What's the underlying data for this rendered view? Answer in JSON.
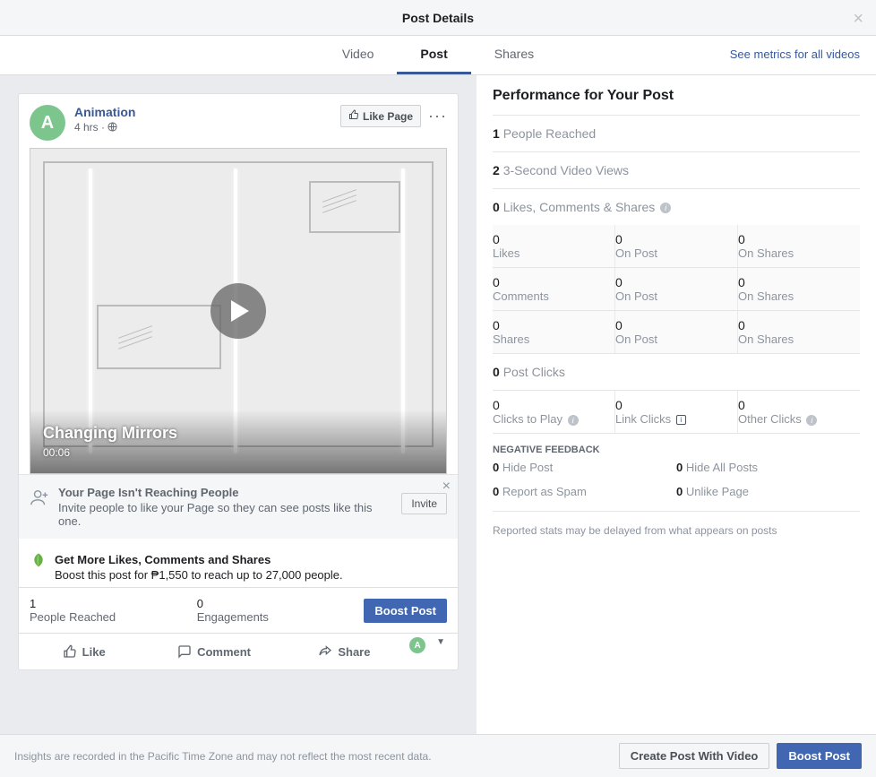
{
  "header": {
    "title": "Post Details"
  },
  "tabs": {
    "video": "Video",
    "post": "Post",
    "shares": "Shares",
    "metrics_link": "See metrics for all videos"
  },
  "post": {
    "avatar_letter": "A",
    "author": "Animation",
    "time": "4 hrs",
    "like_page": "Like Page",
    "video_title": "Changing Mirrors",
    "duration": "00:06"
  },
  "reach_prompt": {
    "title": "Your Page Isn't Reaching People",
    "sub": "Invite people to like your Page so they can see posts like this one.",
    "invite": "Invite"
  },
  "boost_prompt": {
    "title": "Get More Likes, Comments and Shares",
    "sub": "Boost this post for ₱1,550 to reach up to 27,000 people."
  },
  "stats": {
    "reached_val": "1",
    "reached_label": "People Reached",
    "eng_val": "0",
    "eng_label": "Engagements",
    "boost_btn": "Boost Post"
  },
  "actions": {
    "like": "Like",
    "comment": "Comment",
    "share": "Share",
    "mini_avatar": "A"
  },
  "performance": {
    "title": "Performance for Your Post",
    "rows": [
      {
        "val": "1",
        "label": "People Reached"
      },
      {
        "val": "2",
        "label": "3-Second Video Views"
      },
      {
        "val": "0",
        "label": "Likes, Comments & Shares",
        "info": true
      }
    ],
    "breakdown": [
      {
        "c0v": "0",
        "c0l": "Likes",
        "c1v": "0",
        "c1l": "On Post",
        "c2v": "0",
        "c2l": "On Shares"
      },
      {
        "c0v": "0",
        "c0l": "Comments",
        "c1v": "0",
        "c1l": "On Post",
        "c2v": "0",
        "c2l": "On Shares"
      },
      {
        "c0v": "0",
        "c0l": "Shares",
        "c1v": "0",
        "c1l": "On Post",
        "c2v": "0",
        "c2l": "On Shares"
      }
    ],
    "clicks_row": {
      "val": "0",
      "label": "Post Clicks"
    },
    "clicks_breakdown": {
      "c0v": "0",
      "c0l": "Clicks to Play",
      "c1v": "0",
      "c1l": "Link Clicks",
      "c2v": "0",
      "c2l": "Other Clicks"
    },
    "neg_head": "NEGATIVE FEEDBACK",
    "neg": [
      {
        "v": "0",
        "l": "Hide Post"
      },
      {
        "v": "0",
        "l": "Hide All Posts"
      },
      {
        "v": "0",
        "l": "Report as Spam"
      },
      {
        "v": "0",
        "l": "Unlike Page"
      }
    ],
    "disclaimer": "Reported stats may be delayed from what appears on posts"
  },
  "footer": {
    "note": "Insights are recorded in the Pacific Time Zone and may not reflect the most recent data.",
    "create": "Create Post With Video",
    "boost": "Boost Post"
  }
}
